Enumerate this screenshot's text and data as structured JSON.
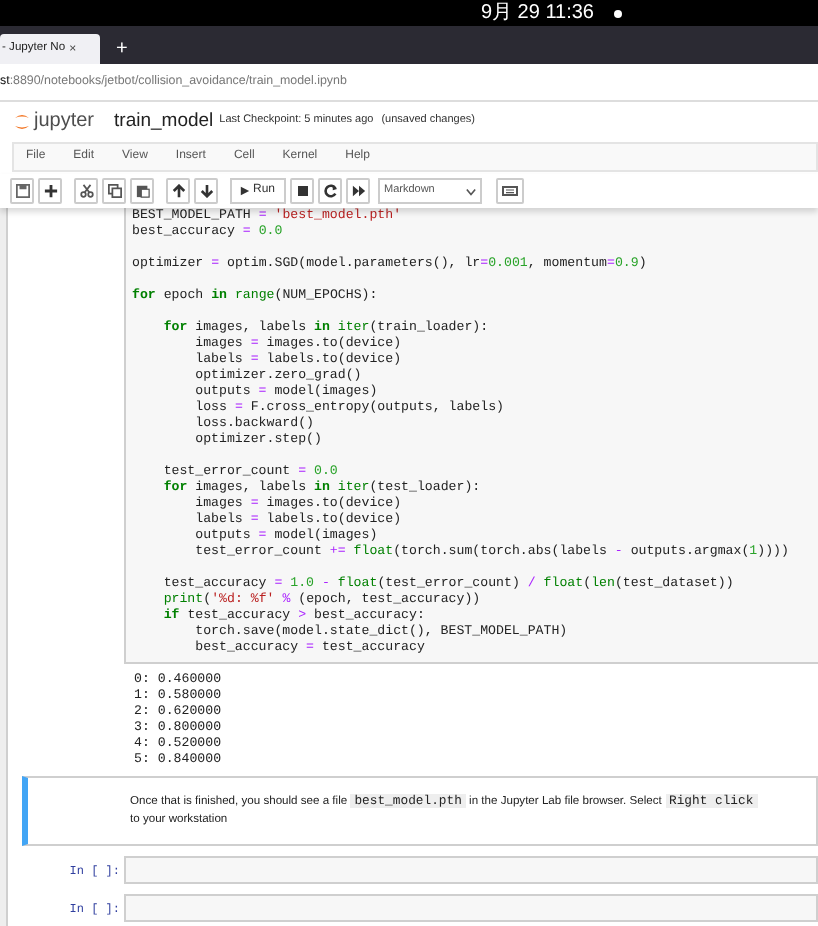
{
  "system_bar": {
    "clock": "9月 29 11:36"
  },
  "browser": {
    "tab": {
      "title": "- Jupyter No",
      "close": "×"
    },
    "new_tab": "+",
    "url_host": "st",
    "url_rest": ":8890/notebooks/jetbot/collision_avoidance/train_model.ipynb"
  },
  "header": {
    "logo": "jupyter",
    "notebook_name": "train_model",
    "checkpoint": "Last Checkpoint: 5 minutes ago",
    "status": "(unsaved changes)"
  },
  "menu": [
    "File",
    "Edit",
    "View",
    "Insert",
    "Cell",
    "Kernel",
    "Help"
  ],
  "toolbar": {
    "run": "Run",
    "cell_type": "Markdown"
  },
  "code_blocks": [
    {
      "lines": [
        {
          "kind": "top",
          "segments": [
            {
              "text": "BEST_MODEL_PATH ",
              "kind": "txt"
            },
            {
              "text": "=",
              "kind": "op"
            },
            {
              "text": " 'best_model.pth'",
              "kind": "str"
            }
          ]
        },
        {
          "kind": "top",
          "segments": [
            {
              "text": "best_accuracy ",
              "kind": "txt"
            },
            {
              "text": "=",
              "kind": "op"
            },
            {
              "text": " 0.0",
              "kind": "num"
            }
          ]
        }
      ]
    },
    {
      "lines": [
        {
          "kind": "top",
          "segments": [
            {
              "text": "optimizer ",
              "kind": "txt"
            },
            {
              "text": "=",
              "kind": "op"
            },
            {
              "text": " optim.SGD(model.parameters(), lr",
              "kind": "txt"
            },
            {
              "text": "=",
              "kind": "op"
            },
            {
              "text": "0.001",
              "kind": "num"
            },
            {
              "text": ", momentum",
              "kind": "txt"
            },
            {
              "text": "=",
              "kind": "op"
            },
            {
              "text": "0.9",
              "kind": "num"
            },
            {
              "text": ")",
              "kind": "txt"
            }
          ]
        }
      ]
    },
    {
      "lines": [
        {
          "kind": "top",
          "segments": [
            {
              "text": "for",
              "kind": "kw"
            },
            {
              "text": " epoch ",
              "kind": "txt"
            },
            {
              "text": "in",
              "kind": "kw"
            },
            {
              "text": " range",
              "kind": "fn"
            },
            {
              "text": "(NUM_EPOCHS):",
              "kind": "txt"
            }
          ]
        }
      ]
    },
    {
      "lines": [
        {
          "kind": "inner",
          "segments": [
            {
              "text": "for",
              "kind": "kw"
            },
            {
              "text": " images, labels ",
              "kind": "txt"
            },
            {
              "text": "in",
              "kind": "kw"
            },
            {
              "text": " iter",
              "kind": "fn"
            },
            {
              "text": "(train_loader):",
              "kind": "txt"
            }
          ]
        },
        {
          "kind": "body",
          "segments": [
            {
              "text": "images ",
              "kind": "txt"
            },
            {
              "text": "=",
              "kind": "op"
            },
            {
              "text": " images.to(device)",
              "kind": "txt"
            }
          ]
        },
        {
          "kind": "body",
          "segments": [
            {
              "text": "labels ",
              "kind": "txt"
            },
            {
              "text": "=",
              "kind": "op"
            },
            {
              "text": " labels.to(device)",
              "kind": "txt"
            }
          ]
        },
        {
          "kind": "body",
          "segments": [
            {
              "text": "optimizer.zero_grad()",
              "kind": "txt"
            }
          ]
        },
        {
          "kind": "body",
          "segments": [
            {
              "text": "outputs ",
              "kind": "txt"
            },
            {
              "text": "=",
              "kind": "op"
            },
            {
              "text": " model(images)",
              "kind": "txt"
            }
          ]
        },
        {
          "kind": "body",
          "segments": [
            {
              "text": "loss ",
              "kind": "txt"
            },
            {
              "text": "=",
              "kind": "op"
            },
            {
              "text": " F.cross_entropy(outputs, labels)",
              "kind": "txt"
            }
          ]
        },
        {
          "kind": "body",
          "segments": [
            {
              "text": "loss.backward()",
              "kind": "txt"
            }
          ]
        },
        {
          "kind": "body",
          "segments": [
            {
              "text": "optimizer.step()",
              "kind": "txt"
            }
          ]
        }
      ]
    },
    {
      "lines": [
        {
          "kind": "inner",
          "segments": [
            {
              "text": "test_error_count ",
              "kind": "txt"
            },
            {
              "text": "=",
              "kind": "op"
            },
            {
              "text": " 0.0",
              "kind": "num"
            }
          ]
        },
        {
          "kind": "inner",
          "segments": [
            {
              "text": "for",
              "kind": "kw"
            },
            {
              "text": " images, labels ",
              "kind": "txt"
            },
            {
              "text": "in",
              "kind": "kw"
            },
            {
              "text": " iter",
              "kind": "fn"
            },
            {
              "text": "(test_loader):",
              "kind": "txt"
            }
          ]
        },
        {
          "kind": "body",
          "segments": [
            {
              "text": "images ",
              "kind": "txt"
            },
            {
              "text": "=",
              "kind": "op"
            },
            {
              "text": " images.to(device)",
              "kind": "txt"
            }
          ]
        },
        {
          "kind": "body",
          "segments": [
            {
              "text": "labels ",
              "kind": "txt"
            },
            {
              "text": "=",
              "kind": "op"
            },
            {
              "text": " labels.to(device)",
              "kind": "txt"
            }
          ]
        },
        {
          "kind": "body",
          "segments": [
            {
              "text": "outputs ",
              "kind": "txt"
            },
            {
              "text": "=",
              "kind": "op"
            },
            {
              "text": " model(images)",
              "kind": "txt"
            }
          ]
        },
        {
          "kind": "body",
          "segments": [
            {
              "text": "test_error_count ",
              "kind": "txt"
            },
            {
              "text": "+=",
              "kind": "op"
            },
            {
              "text": " float",
              "kind": "fn"
            },
            {
              "text": "(torch.sum(torch.abs(labels ",
              "kind": "txt"
            },
            {
              "text": "-",
              "kind": "op"
            },
            {
              "text": " outputs.argmax(",
              "kind": "txt"
            },
            {
              "text": "1",
              "kind": "num"
            },
            {
              "text": "))))",
              "kind": "txt"
            }
          ]
        }
      ]
    },
    {
      "lines": [
        {
          "kind": "inner",
          "segments": [
            {
              "text": "test_accuracy ",
              "kind": "txt"
            },
            {
              "text": "=",
              "kind": "op"
            },
            {
              "text": " 1.0",
              "kind": "num"
            },
            {
              "text": " -",
              "kind": "op"
            },
            {
              "text": " float",
              "kind": "fn"
            },
            {
              "text": "(test_error_count) ",
              "kind": "txt"
            },
            {
              "text": "/",
              "kind": "op"
            },
            {
              "text": " float",
              "kind": "fn"
            },
            {
              "text": "(",
              "kind": "txt"
            },
            {
              "text": "len",
              "kind": "fn"
            },
            {
              "text": "(test_dataset))",
              "kind": "txt"
            }
          ]
        },
        {
          "kind": "inner",
          "segments": [
            {
              "text": "print",
              "kind": "fn"
            },
            {
              "text": "(",
              "kind": "txt"
            },
            {
              "text": "'%d: %f'",
              "kind": "str"
            },
            {
              "text": " %",
              "kind": "op"
            },
            {
              "text": " (epoch, test_accuracy))",
              "kind": "txt"
            }
          ]
        },
        {
          "kind": "inner",
          "segments": [
            {
              "text": "if",
              "kind": "kw"
            },
            {
              "text": " test_accuracy ",
              "kind": "txt"
            },
            {
              "text": ">",
              "kind": "op"
            },
            {
              "text": " best_accuracy:",
              "kind": "txt"
            }
          ]
        },
        {
          "kind": "body",
          "segments": [
            {
              "text": "torch.save(model.state_dict(), BEST_MODEL_PATH)",
              "kind": "txt"
            }
          ]
        },
        {
          "kind": "body",
          "segments": [
            {
              "text": "best_accuracy ",
              "kind": "txt"
            },
            {
              "text": "=",
              "kind": "op"
            },
            {
              "text": " test_accuracy",
              "kind": "txt"
            }
          ]
        }
      ]
    }
  ],
  "output_lines": [
    "0: 0.460000",
    "1: 0.580000",
    "2: 0.620000",
    "3: 0.800000",
    "4: 0.520000",
    "5: 0.840000"
  ],
  "markdown_cell": {
    "selected": true,
    "lines": [
      [
        {
          "text": "Once that is finished, you should see a file ",
          "kind": "txt"
        },
        {
          "text": "best_model.pth",
          "kind": "code"
        },
        {
          "text": " in the Jupyter Lab file browser. Select ",
          "kind": "txt"
        },
        {
          "text": "Right click",
          "kind": "code"
        }
      ],
      [
        {
          "text": "to your workstation",
          "kind": "txt"
        }
      ]
    ]
  },
  "empty_cells": [
    {
      "prompt": "In [ ]:"
    },
    {
      "prompt": "In [ ]:"
    }
  ]
}
